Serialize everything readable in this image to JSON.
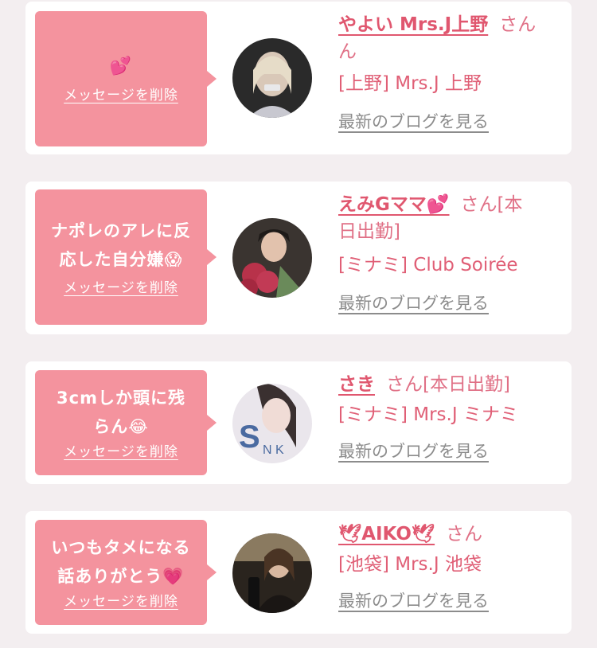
{
  "cards": [
    {
      "message_lines": [
        "💕"
      ],
      "delete_label": "メッセージを削除",
      "name": "やよい Mrs.J上野",
      "honorific": "さん",
      "name_wrap": "ん",
      "status": "",
      "shop": "[上野] Mrs.J 上野",
      "blog_label": "最新のブログを見る"
    },
    {
      "message_lines": [
        "ナポレのアレに反",
        "応した自分嫌😱"
      ],
      "delete_label": "メッセージを削除",
      "name": "えみGママ💕",
      "honorific": "さん[本",
      "name_wrap": "日出勤]",
      "shop": "[ミナミ] Club Soirée",
      "blog_label": "最新のブログを見る"
    },
    {
      "message_lines": [
        "3cmしか頭に残",
        "らん😂"
      ],
      "delete_label": "メッセージを削除",
      "name": "さき",
      "honorific": "さん[本日出勤]",
      "shop": "[ミナミ] Mrs.J ミナミ",
      "blog_label": "最新のブログを見る"
    },
    {
      "message_lines": [
        "いつもタメになる",
        "話ありがとう💗"
      ],
      "delete_label": "メッセージを削除",
      "name": "🕊AIKO🕊",
      "honorific": "さん",
      "shop": "[池袋] Mrs.J 池袋",
      "blog_label": "最新のブログを見る"
    }
  ],
  "colors": {
    "accent": "#e0576f",
    "bubble": "#f4939e",
    "link_gray": "#8c8c8c"
  },
  "icons": [
    "avatar-photo"
  ]
}
